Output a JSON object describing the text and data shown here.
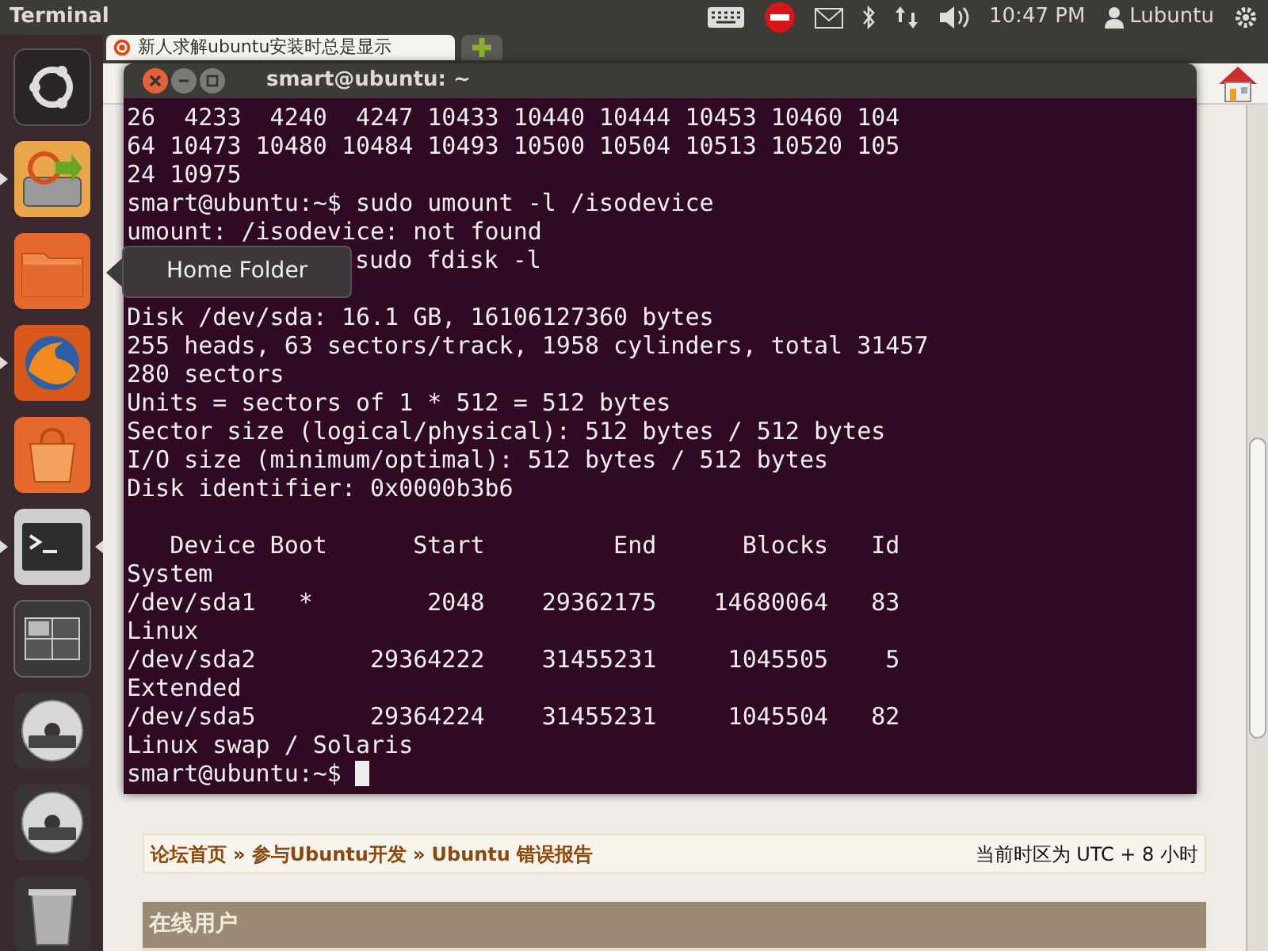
{
  "top_panel": {
    "app_title": "Terminal",
    "clock": "10:47 PM",
    "user": "Lubuntu"
  },
  "launcher": {
    "items": [
      {
        "kind": "dash",
        "running": false,
        "focused": false
      },
      {
        "kind": "installer",
        "running": true,
        "focused": false
      },
      {
        "kind": "folder",
        "running": false,
        "focused": false
      },
      {
        "kind": "browser",
        "running": true,
        "focused": false
      },
      {
        "kind": "shop",
        "running": false,
        "focused": false
      },
      {
        "kind": "terminal",
        "running": true,
        "focused": true
      },
      {
        "kind": "workspaces",
        "running": false,
        "focused": false
      },
      {
        "kind": "dvd",
        "running": false,
        "focused": false
      },
      {
        "kind": "dvd",
        "running": false,
        "focused": false
      },
      {
        "kind": "trash",
        "running": false,
        "focused": false
      }
    ],
    "tooltip": "Home Folder"
  },
  "browser": {
    "tab_title": "新人求解ubuntu安装时总是显示",
    "breadcrumb": [
      "论坛首页",
      "参与Ubuntu开发",
      "Ubuntu 错误报告"
    ],
    "breadcrumb_separator": "»",
    "timezone": "当前时区为 UTC + 8 小时",
    "section_header": "在线用户"
  },
  "terminal": {
    "title": "smart@ubuntu: ~",
    "lines": [
      {
        "kind": "text",
        "text": "26  4233  4240  4247 10433 10440 10444 10453 10460 104"
      },
      {
        "kind": "text",
        "text": "64 10473 10480 10484 10493 10500 10504 10513 10520 105"
      },
      {
        "kind": "text",
        "text": "24 10975"
      },
      {
        "kind": "text",
        "text": "smart@ubuntu:~$ sudo umount -l /isodevice"
      },
      {
        "kind": "text",
        "text": "umount: /isodevice: not found"
      },
      {
        "kind": "after_hidden_prompt",
        "text": "sudo fdisk -l"
      },
      {
        "kind": "blank"
      },
      {
        "kind": "text",
        "text": "Disk /dev/sda: 16.1 GB, 16106127360 bytes"
      },
      {
        "kind": "text",
        "text": "255 heads, 63 sectors/track, 1958 cylinders, total 31457"
      },
      {
        "kind": "text",
        "text": "280 sectors"
      },
      {
        "kind": "text",
        "text": "Units = sectors of 1 * 512 = 512 bytes"
      },
      {
        "kind": "text",
        "text": "Sector size (logical/physical): 512 bytes / 512 bytes"
      },
      {
        "kind": "text",
        "text": "I/O size (minimum/optimal): 512 bytes / 512 bytes"
      },
      {
        "kind": "text",
        "text": "Disk identifier: 0x0000b3b6"
      },
      {
        "kind": "blank"
      },
      {
        "kind": "text",
        "text": "   Device Boot      Start         End      Blocks   Id"
      },
      {
        "kind": "text",
        "text": "System"
      },
      {
        "kind": "text",
        "text": "/dev/sda1   *        2048    29362175    14680064   83"
      },
      {
        "kind": "text",
        "text": "Linux"
      },
      {
        "kind": "text",
        "text": "/dev/sda2        29364222    31455231     1045505    5"
      },
      {
        "kind": "text",
        "text": "Extended"
      },
      {
        "kind": "text",
        "text": "/dev/sda5        29364224    31455231     1045504   82"
      },
      {
        "kind": "text",
        "text": "Linux swap / Solaris"
      },
      {
        "kind": "prompt",
        "text": "smart@ubuntu:~$"
      }
    ]
  }
}
